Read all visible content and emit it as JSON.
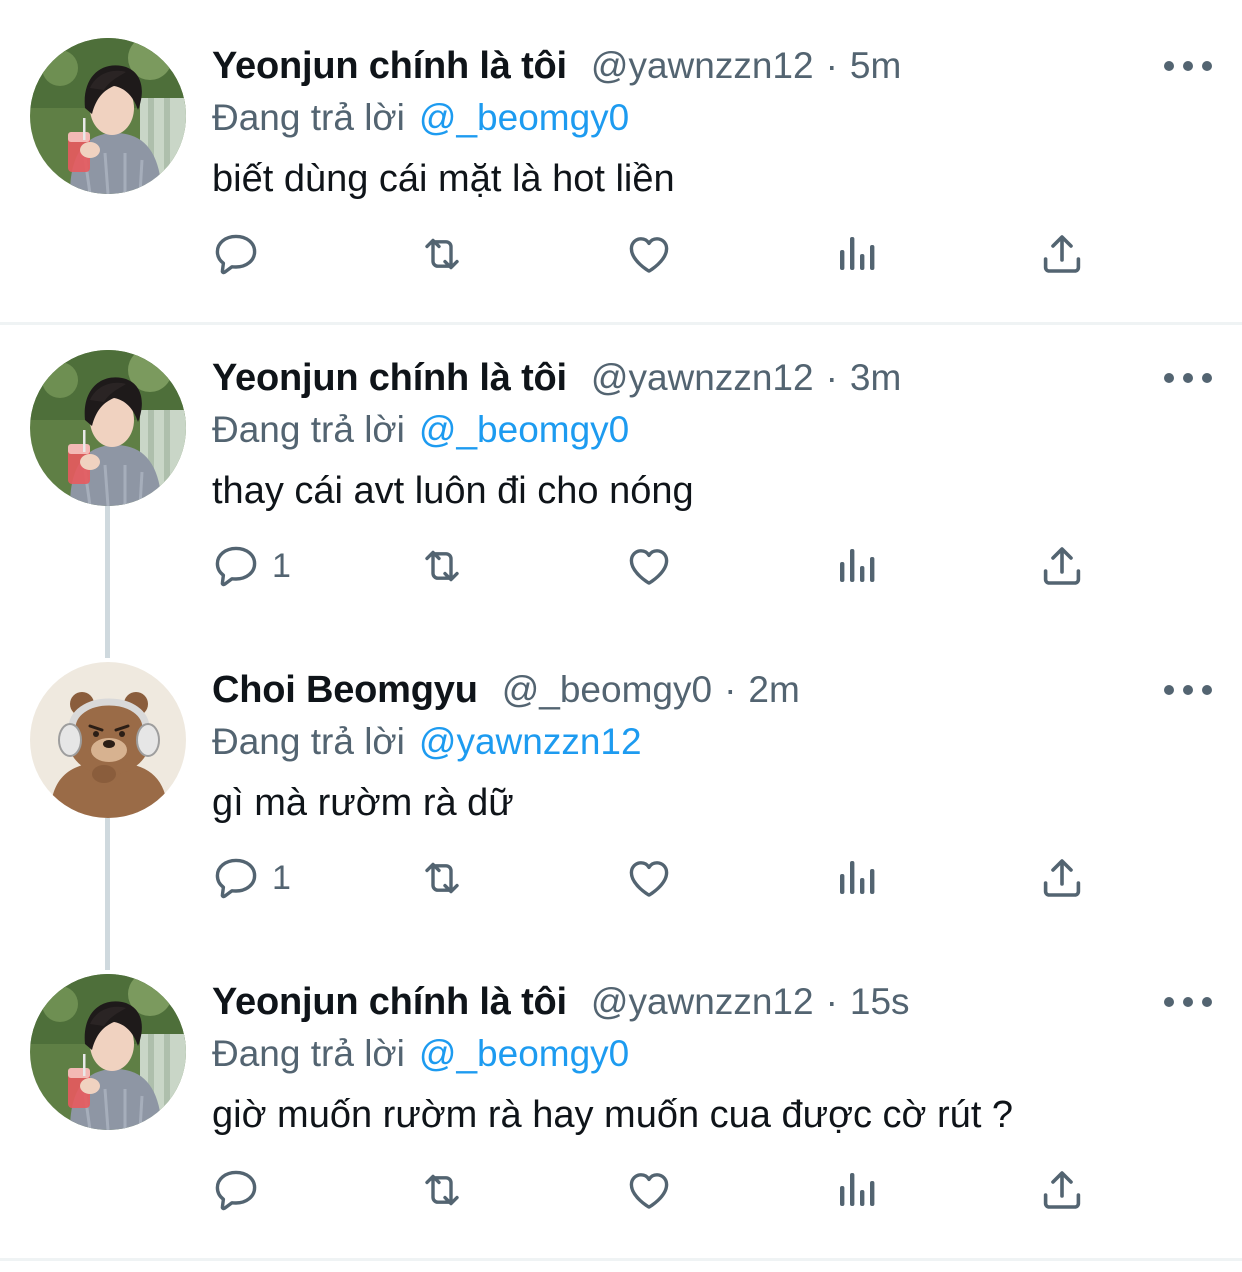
{
  "tweets": [
    {
      "name": "Yeonjun chính là tôi",
      "handle": "@yawnzzn12",
      "dot": "·",
      "time": "5m",
      "reply_prefix": "Đang trả lời",
      "reply_to": "@_beomgy0",
      "text": "biết dùng cái mặt là hot liền",
      "reply_count": "",
      "avatar": "yeonjun-photo"
    },
    {
      "name": "Yeonjun chính là tôi",
      "handle": "@yawnzzn12",
      "dot": "·",
      "time": "3m",
      "reply_prefix": "Đang trả lời",
      "reply_to": "@_beomgy0",
      "text": "thay cái avt luôn đi cho nóng",
      "reply_count": "1",
      "avatar": "yeonjun-photo"
    },
    {
      "name": "Choi Beomgyu",
      "handle": "@_beomgy0",
      "dot": "·",
      "time": "2m",
      "reply_prefix": "Đang trả lời",
      "reply_to": "@yawnzzn12",
      "text": "gì mà rườm rà dữ",
      "reply_count": "1",
      "avatar": "bear-with-headphones"
    },
    {
      "name": "Yeonjun chính là tôi",
      "handle": "@yawnzzn12",
      "dot": "·",
      "time": "15s",
      "reply_prefix": "Đang trả lời",
      "reply_to": "@_beomgy0",
      "text": "giờ muốn rườm rà hay muốn cua được cờ rút ?",
      "reply_count": "",
      "avatar": "yeonjun-photo"
    }
  ],
  "icons": [
    "reply-icon",
    "retweet-icon",
    "like-icon",
    "analytics-icon",
    "share-icon",
    "more-icon"
  ],
  "colors": {
    "link": "#1d9bf0",
    "secondary": "#536471",
    "text": "#0f1419",
    "divider": "#eff3f4",
    "thread_line": "#cfd9de"
  }
}
